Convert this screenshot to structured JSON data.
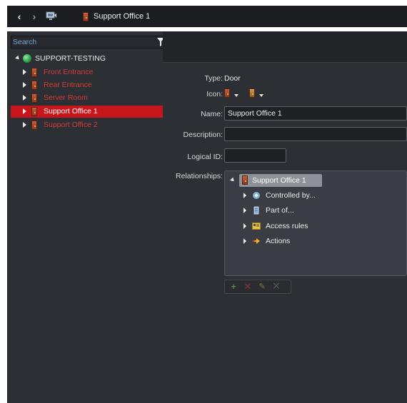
{
  "window": {
    "title": "Support Office 1"
  },
  "nav": {
    "back_icon": "chevron-left-icon",
    "forward_icon": "chevron-right-icon",
    "monitor_icon": "monitor-icon"
  },
  "sidebar": {
    "search_placeholder": "Search",
    "root_label": "SUPPORT-TESTING",
    "items": [
      {
        "label": "Front Entrance",
        "selected": false
      },
      {
        "label": "Rear Entrance",
        "selected": false
      },
      {
        "label": "Server Room",
        "selected": false
      },
      {
        "label": "Support Office 1",
        "selected": true
      },
      {
        "label": "Support Office 2",
        "selected": false
      }
    ]
  },
  "form": {
    "type_label": "Type:",
    "type_value": "Door",
    "icon_label": "Icon:",
    "name_label": "Name:",
    "name_value": "Support Office 1",
    "description_label": "Description:",
    "description_value": "",
    "logical_id_label": "Logical ID:",
    "logical_id_value": "",
    "relationships_label": "Relationships:"
  },
  "relationships": {
    "root": "Support Office 1",
    "children": [
      {
        "label": "Controlled by...",
        "icon": "controller-icon"
      },
      {
        "label": "Part of...",
        "icon": "building-icon"
      },
      {
        "label": "Access rules",
        "icon": "access-rule-icon"
      },
      {
        "label": "Actions",
        "icon": "action-icon"
      }
    ]
  },
  "colors": {
    "selected_row": "#c6161b",
    "entity_red": "#d43a3a",
    "panel_bg": "#2c2f34",
    "header_bg": "#1b1d20"
  }
}
